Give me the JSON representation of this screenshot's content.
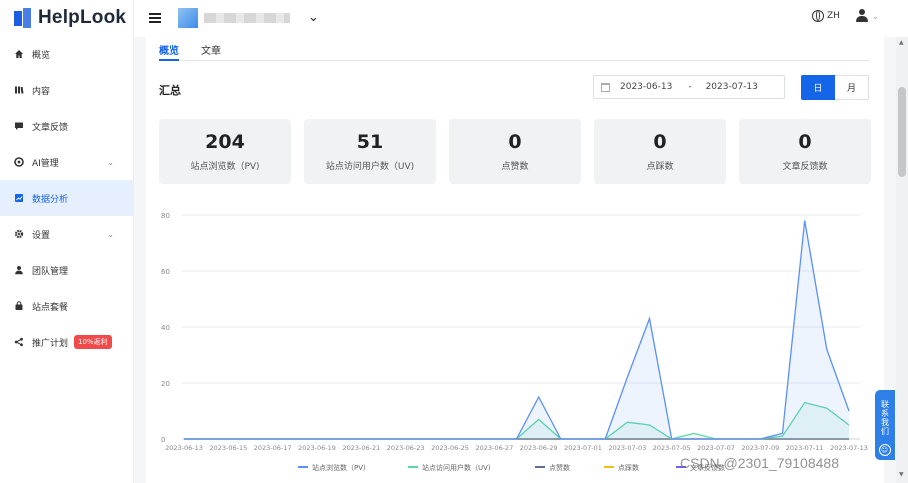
{
  "brand": {
    "name": "HelpLook",
    "color": "#1565e8"
  },
  "sidebar": {
    "items": [
      {
        "label": "概览",
        "icon": "home-icon"
      },
      {
        "label": "内容",
        "icon": "book-icon"
      },
      {
        "label": "文章反馈",
        "icon": "comment-icon"
      },
      {
        "label": "AI管理",
        "icon": "ai-icon",
        "expandable": true
      },
      {
        "label": "数据分析",
        "icon": "chart-icon",
        "active": true
      },
      {
        "label": "设置",
        "icon": "gear-icon",
        "expandable": true
      },
      {
        "label": "团队管理",
        "icon": "team-icon"
      },
      {
        "label": "站点套餐",
        "icon": "bag-icon"
      },
      {
        "label": "推广计划",
        "icon": "share-icon",
        "badge": "10%返利"
      }
    ]
  },
  "topbar": {
    "lang": "ZH"
  },
  "tabs": [
    {
      "label": "概览",
      "active": true
    },
    {
      "label": "文章",
      "active": false
    }
  ],
  "section": {
    "title": "汇总"
  },
  "date_range": {
    "start": "2023-06-13",
    "separator": "-",
    "end": "2023-07-13"
  },
  "period": {
    "day": "日",
    "month": "月",
    "selected": "日"
  },
  "stats": [
    {
      "value": "204",
      "label": "站点浏览数（PV)"
    },
    {
      "value": "51",
      "label": "站点访问用户数（UV)"
    },
    {
      "value": "0",
      "label": "点赞数"
    },
    {
      "value": "0",
      "label": "点踩数"
    },
    {
      "value": "0",
      "label": "文章反馈数"
    }
  ],
  "float_help": "联系我们",
  "watermark": "CSDN @2301_79108488",
  "chart_data": {
    "type": "line",
    "x": [
      "2023-06-13",
      "2023-06-14",
      "2023-06-15",
      "2023-06-16",
      "2023-06-17",
      "2023-06-18",
      "2023-06-19",
      "2023-06-20",
      "2023-06-21",
      "2023-06-22",
      "2023-06-23",
      "2023-06-24",
      "2023-06-25",
      "2023-06-26",
      "2023-06-27",
      "2023-06-28",
      "2023-06-29",
      "2023-06-30",
      "2023-07-01",
      "2023-07-02",
      "2023-07-03",
      "2023-07-04",
      "2023-07-05",
      "2023-07-06",
      "2023-07-07",
      "2023-07-08",
      "2023-07-09",
      "2023-07-10",
      "2023-07-11",
      "2023-07-12",
      "2023-07-13"
    ],
    "x_tick_labels": [
      "2023-06-13",
      "2023-06-15",
      "2023-06-17",
      "2023-06-19",
      "2023-06-21",
      "2023-06-23",
      "2023-06-25",
      "2023-06-27",
      "2023-06-29",
      "2023-07-01",
      "2023-07-03",
      "2023-07-05",
      "2023-07-07",
      "2023-07-09",
      "2023-07-11",
      "2023-07-13"
    ],
    "ylim": [
      0,
      80
    ],
    "y_ticks": [
      0,
      20,
      40,
      60,
      80
    ],
    "grid": true,
    "legend_position": "bottom",
    "series": [
      {
        "name": "站点浏览数（PV)",
        "color": "#5b8ff9",
        "area": true,
        "values": [
          0,
          0,
          0,
          0,
          0,
          0,
          0,
          0,
          0,
          0,
          0,
          0,
          0,
          0,
          0,
          0,
          15,
          0,
          0,
          0,
          22,
          43,
          0,
          0,
          0,
          0,
          0,
          2,
          78,
          32,
          10
        ]
      },
      {
        "name": "站点访问用户数（UV)",
        "color": "#5ad8a6",
        "area": true,
        "values": [
          0,
          0,
          0,
          0,
          0,
          0,
          0,
          0,
          0,
          0,
          0,
          0,
          0,
          0,
          0,
          0,
          7,
          0,
          0,
          0,
          6,
          5,
          0,
          2,
          0,
          0,
          0,
          1,
          13,
          11,
          5
        ]
      },
      {
        "name": "点赞数",
        "color": "#5d7092",
        "values": [
          0,
          0,
          0,
          0,
          0,
          0,
          0,
          0,
          0,
          0,
          0,
          0,
          0,
          0,
          0,
          0,
          0,
          0,
          0,
          0,
          0,
          0,
          0,
          0,
          0,
          0,
          0,
          0,
          0,
          0,
          0
        ]
      },
      {
        "name": "点踩数",
        "color": "#f6bd16",
        "values": [
          0,
          0,
          0,
          0,
          0,
          0,
          0,
          0,
          0,
          0,
          0,
          0,
          0,
          0,
          0,
          0,
          0,
          0,
          0,
          0,
          0,
          0,
          0,
          0,
          0,
          0,
          0,
          0,
          0,
          0,
          0
        ]
      },
      {
        "name": "文章反馈数",
        "color": "#6f5ef9",
        "values": [
          0,
          0,
          0,
          0,
          0,
          0,
          0,
          0,
          0,
          0,
          0,
          0,
          0,
          0,
          0,
          0,
          0,
          0,
          0,
          0,
          0,
          0,
          0,
          0,
          0,
          0,
          0,
          0,
          0,
          0,
          0
        ]
      }
    ]
  }
}
